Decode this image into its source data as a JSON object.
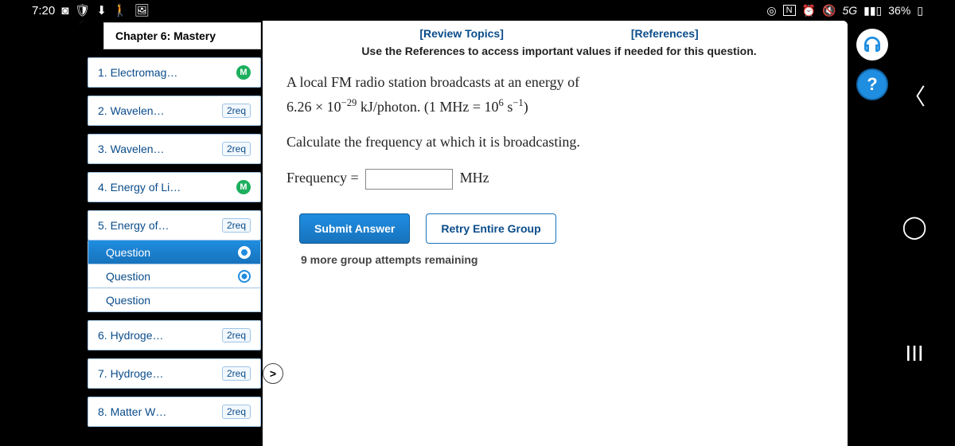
{
  "status": {
    "time": "7:20",
    "network": "5G",
    "battery": "36%"
  },
  "sidebar": {
    "chapter": "Chapter 6: Mastery",
    "items": [
      {
        "label": "1. Electromag…",
        "badge_type": "m",
        "badge": "M"
      },
      {
        "label": "2. Wavelen…",
        "badge_type": "req",
        "badge": "2req"
      },
      {
        "label": "3. Wavelen…",
        "badge_type": "req",
        "badge": "2req"
      },
      {
        "label": "4. Energy of Li…",
        "badge_type": "m",
        "badge": "M"
      },
      {
        "label": "5. Energy of…",
        "badge_type": "req",
        "badge": "2req"
      },
      {
        "label": "6. Hydroge…",
        "badge_type": "req",
        "badge": "2req"
      },
      {
        "label": "7. Hydroge…",
        "badge_type": "req",
        "badge": "2req"
      },
      {
        "label": "8. Matter W…",
        "badge_type": "req",
        "badge": "2req"
      }
    ],
    "subitems": [
      {
        "label": "Question"
      },
      {
        "label": "Question"
      },
      {
        "label": "Question"
      }
    ]
  },
  "content": {
    "links": {
      "review": "[Review Topics]",
      "references": "[References]"
    },
    "instruction": "Use the References to access important values if needed for this question.",
    "problem_line1_a": "A local FM radio station broadcasts at an energy of",
    "problem_line1_b": "6.26 × 10",
    "problem_line1_exp": "−29",
    "problem_line1_c": " kJ/photon. (1 MHz = 10",
    "problem_line1_exp2": "6",
    "problem_line1_d": " s",
    "problem_line1_exp3": "−1",
    "problem_line1_e": ")",
    "problem_line2": "Calculate the frequency at which it is broadcasting.",
    "answer_label": "Frequency =",
    "answer_unit": "MHz",
    "submit": "Submit Answer",
    "retry": "Retry Entire Group",
    "attempts": "9 more group attempts remaining"
  },
  "icons": {
    "help": "?"
  }
}
